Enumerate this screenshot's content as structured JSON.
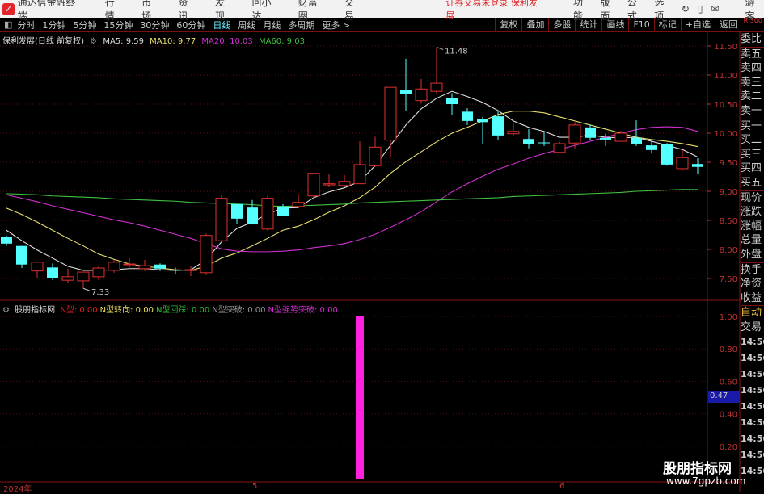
{
  "app": {
    "title": "通达信金融终端",
    "menu": [
      "行情",
      "市场",
      "资讯",
      "发现",
      "问小达",
      "财富圈",
      "交易"
    ],
    "status": "证券交易未登录  保利发展",
    "right_menu": [
      "功能",
      "版面",
      "公式",
      "选项"
    ],
    "user": "游客"
  },
  "toolbar": {
    "periods": [
      "分时",
      "1分钟",
      "5分钟",
      "15分钟",
      "30分钟",
      "60分钟",
      "日线",
      "周线",
      "月线",
      "多周期",
      "更多 >"
    ],
    "active": "日线",
    "buttons": [
      "复权",
      "叠加",
      "多股",
      "统计",
      "画线",
      "F10",
      "标记",
      "+自选",
      "返回"
    ],
    "badge": "R 300"
  },
  "info": {
    "stock": "保利发展(日线 前复权)",
    "ma5": "MA5: 9.59",
    "ma10": "MA10: 9.77",
    "ma20": "MA20: 10.03",
    "ma60": "MA60: 9.03"
  },
  "indicator": {
    "name": "股朋指标网",
    "items": [
      {
        "label": "N型: 0.00",
        "color": "#e02020"
      },
      {
        "label": "N型转向: 0.00",
        "color": "#e8e060"
      },
      {
        "label": "N型回踩: 0.00",
        "color": "#30c030"
      },
      {
        "label": "N型突破: 0.00",
        "color": "#999999"
      },
      {
        "label": "N型强势突破: 0.00",
        "color": "#d030d0"
      }
    ],
    "current_value": "0.47"
  },
  "right_panel": {
    "labels": [
      "委比",
      "卖五",
      "卖四",
      "卖三",
      "卖二",
      "卖一",
      "买一",
      "买二",
      "买三",
      "买四",
      "买五",
      "现价",
      "涨跌",
      "涨幅",
      "总量",
      "外盘",
      "换手",
      "净资",
      "收益"
    ],
    "auto": "自动",
    "trade": "交易",
    "times": [
      "14:56",
      "14:56",
      "14:56",
      "14:56",
      "14:56",
      "14:56",
      "14:56",
      "14:56",
      "14:56"
    ]
  },
  "x_axis": {
    "labels": [
      "2024年",
      "5",
      "6"
    ]
  },
  "watermark": {
    "name": "股朋指标网",
    "url": "www.7gpzb.com"
  },
  "colors": {
    "up": "#e03030",
    "down": "#54ffff",
    "ma5": "#e0e0e0",
    "ma10": "#e8e070",
    "ma20": "#d030d0",
    "ma60": "#40c040",
    "signal": "#ff20e0"
  },
  "chart_data": [
    {
      "type": "candlestick",
      "y_ticks": [
        11.5,
        11.0,
        10.5,
        10.0,
        9.5,
        9.0,
        8.5,
        8.0,
        7.5
      ],
      "ylim": [
        7.2,
        11.7
      ],
      "annotations": {
        "high": "11.48",
        "low": "7.33"
      },
      "candles": [
        [
          8.21,
          8.24,
          8.06,
          8.1
        ],
        [
          8.06,
          8.06,
          7.68,
          7.74
        ],
        [
          7.63,
          7.78,
          7.5,
          7.78
        ],
        [
          7.69,
          7.76,
          7.47,
          7.51
        ],
        [
          7.47,
          7.67,
          7.43,
          7.53
        ],
        [
          7.46,
          7.61,
          7.33,
          7.61
        ],
        [
          7.53,
          7.72,
          7.47,
          7.68
        ],
        [
          7.64,
          7.82,
          7.6,
          7.78
        ],
        [
          7.75,
          7.85,
          7.67,
          7.75
        ],
        [
          7.67,
          7.82,
          7.63,
          7.72
        ],
        [
          7.74,
          7.76,
          7.63,
          7.67
        ],
        [
          7.65,
          7.69,
          7.57,
          7.64
        ],
        [
          7.65,
          7.71,
          7.54,
          7.65
        ],
        [
          7.6,
          8.27,
          7.56,
          8.24
        ],
        [
          8.15,
          8.93,
          8.13,
          8.88
        ],
        [
          8.78,
          8.78,
          8.43,
          8.53
        ],
        [
          8.72,
          8.85,
          8.43,
          8.43
        ],
        [
          8.35,
          8.92,
          8.32,
          8.88
        ],
        [
          8.74,
          8.78,
          8.57,
          8.58
        ],
        [
          8.74,
          8.96,
          8.71,
          8.81
        ],
        [
          8.92,
          9.31,
          8.85,
          9.31
        ],
        [
          9.11,
          9.29,
          9.07,
          9.13
        ],
        [
          9.1,
          9.28,
          9.07,
          9.17
        ],
        [
          9.13,
          9.86,
          9.13,
          9.46
        ],
        [
          9.44,
          9.94,
          9.42,
          9.76
        ],
        [
          9.88,
          10.79,
          9.58,
          10.79
        ],
        [
          10.74,
          11.28,
          10.39,
          10.67
        ],
        [
          10.56,
          10.93,
          10.51,
          10.76
        ],
        [
          10.72,
          11.48,
          10.67,
          10.86
        ],
        [
          10.61,
          10.69,
          10.32,
          10.5
        ],
        [
          10.37,
          10.43,
          10.14,
          10.21
        ],
        [
          10.24,
          10.28,
          9.82,
          10.19
        ],
        [
          10.29,
          10.38,
          9.88,
          9.96
        ],
        [
          9.99,
          10.17,
          9.96,
          10.03
        ],
        [
          9.9,
          10.07,
          9.74,
          9.82
        ],
        [
          9.84,
          10.03,
          9.78,
          9.83
        ],
        [
          9.67,
          9.86,
          9.67,
          9.82
        ],
        [
          9.83,
          10.19,
          9.74,
          10.14
        ],
        [
          10.1,
          10.15,
          9.88,
          9.92
        ],
        [
          9.92,
          9.99,
          9.78,
          9.89
        ],
        [
          9.86,
          10.04,
          9.86,
          10.0
        ],
        [
          9.92,
          10.22,
          9.78,
          9.82
        ],
        [
          9.79,
          9.86,
          9.65,
          9.71
        ],
        [
          9.81,
          9.83,
          9.44,
          9.46
        ],
        [
          9.39,
          9.71,
          9.35,
          9.58
        ],
        [
          9.47,
          9.57,
          9.29,
          9.42
        ]
      ],
      "series": [
        {
          "name": "MA5",
          "values": [
            8.33,
            8.15,
            7.99,
            7.85,
            7.71,
            7.64,
            7.64,
            7.65,
            7.67,
            7.67,
            7.65,
            7.64,
            7.65,
            7.82,
            8.13,
            8.36,
            8.47,
            8.61,
            8.71,
            8.72,
            8.89,
            8.99,
            9.06,
            9.17,
            9.44,
            9.79,
            10.14,
            10.42,
            10.6,
            10.72,
            10.63,
            10.53,
            10.39,
            10.21,
            10.1,
            10.03,
            9.93,
            9.93,
            9.97,
            9.93,
            9.92,
            9.93,
            9.86,
            9.79,
            9.72,
            9.59
          ]
        },
        {
          "name": "MA10",
          "values": [
            8.71,
            8.6,
            8.47,
            8.33,
            8.19,
            8.06,
            7.92,
            7.83,
            7.75,
            7.71,
            7.68,
            7.65,
            7.64,
            7.71,
            7.85,
            7.94,
            8.06,
            8.19,
            8.33,
            8.4,
            8.51,
            8.64,
            8.75,
            8.89,
            9.07,
            9.31,
            9.51,
            9.68,
            9.85,
            10.0,
            10.1,
            10.21,
            10.32,
            10.38,
            10.38,
            10.35,
            10.28,
            10.21,
            10.14,
            10.07,
            10.0,
            9.93,
            9.89,
            9.86,
            9.82,
            9.77
          ]
        },
        {
          "name": "MA20",
          "values": [
            8.94,
            8.88,
            8.82,
            8.75,
            8.69,
            8.63,
            8.57,
            8.51,
            8.46,
            8.4,
            8.33,
            8.26,
            8.19,
            8.1,
            8.01,
            7.97,
            7.96,
            7.96,
            7.97,
            7.99,
            8.03,
            8.06,
            8.1,
            8.17,
            8.26,
            8.38,
            8.51,
            8.65,
            8.82,
            8.99,
            9.13,
            9.26,
            9.38,
            9.47,
            9.57,
            9.65,
            9.72,
            9.79,
            9.86,
            9.93,
            10.0,
            10.06,
            10.1,
            10.11,
            10.1,
            10.03
          ]
        },
        {
          "name": "MA60",
          "values": [
            8.96,
            8.95,
            8.94,
            8.92,
            8.91,
            8.9,
            8.89,
            8.87,
            8.86,
            8.85,
            8.84,
            8.83,
            8.81,
            8.8,
            8.79,
            8.78,
            8.77,
            8.75,
            8.74,
            8.75,
            8.76,
            8.77,
            8.78,
            8.8,
            8.81,
            8.82,
            8.83,
            8.84,
            8.85,
            8.86,
            8.87,
            8.88,
            8.89,
            8.91,
            8.92,
            8.93,
            8.94,
            8.95,
            8.96,
            8.97,
            8.98,
            9.0,
            9.01,
            9.02,
            9.03,
            9.03
          ]
        }
      ]
    },
    {
      "type": "bar",
      "y_ticks": [
        1.0,
        0.8,
        0.6,
        0.4,
        0.2
      ],
      "ylim": [
        0,
        1.0
      ],
      "bars": [
        {
          "index": 23,
          "value": 1.0
        }
      ]
    }
  ]
}
